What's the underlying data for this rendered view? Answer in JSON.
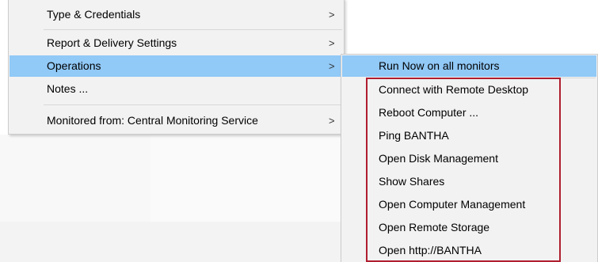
{
  "main_menu": {
    "items": [
      {
        "label": "Type & Credentials",
        "has_submenu": true,
        "highlighted": false
      },
      {
        "label": "Report & Delivery Settings",
        "has_submenu": true,
        "highlighted": false
      },
      {
        "label": "Operations",
        "has_submenu": true,
        "highlighted": true
      },
      {
        "label": "Notes ...",
        "has_submenu": false,
        "highlighted": false
      },
      {
        "label": "Monitored from: Central Monitoring Service",
        "has_submenu": true,
        "highlighted": false
      }
    ],
    "arrow_glyph": ">"
  },
  "operations_submenu": {
    "items": [
      {
        "label": "Run Now on all monitors",
        "highlighted": true
      },
      {
        "label": "Connect with Remote Desktop"
      },
      {
        "label": "Reboot Computer ..."
      },
      {
        "label": "Ping BANTHA"
      },
      {
        "label": "Open Disk Management"
      },
      {
        "label": "Show Shares"
      },
      {
        "label": "Open Computer Management"
      },
      {
        "label": "Open Remote Storage"
      },
      {
        "label": "Open http://BANTHA"
      }
    ]
  },
  "colors": {
    "highlight": "#91c9f7",
    "menu_bg": "#f2f2f2",
    "annotation_border": "#b01e2f"
  }
}
